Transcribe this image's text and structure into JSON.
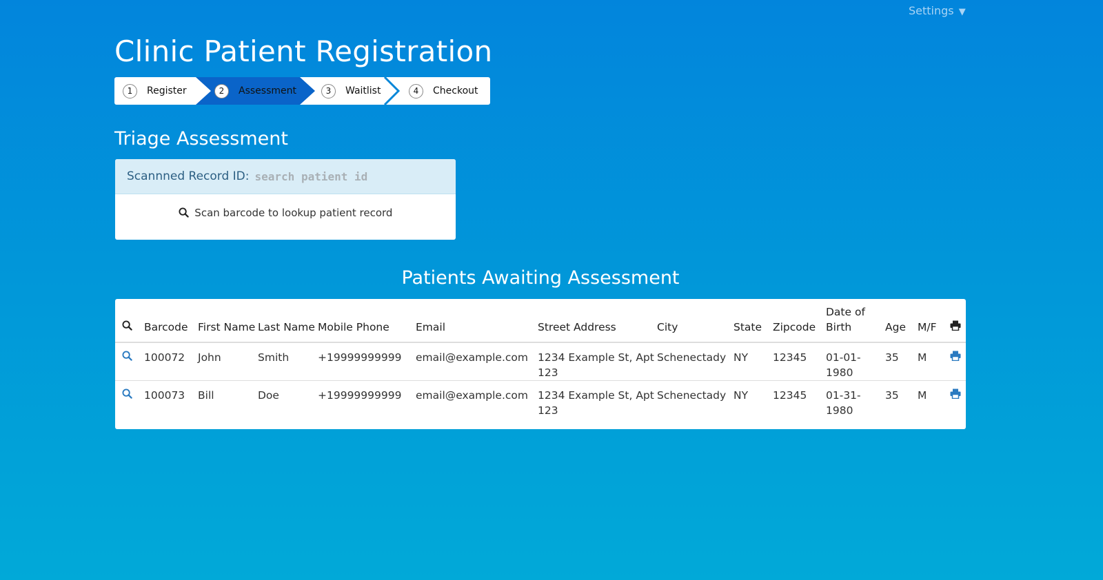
{
  "header": {
    "settings_label": "Settings",
    "settings_caret": "▼",
    "title": "Clinic Patient Registration"
  },
  "steps": [
    {
      "number": "1",
      "label": "Register",
      "active": false
    },
    {
      "number": "2",
      "label": "Assessment",
      "active": true
    },
    {
      "number": "3",
      "label": "Waitlist",
      "active": false
    },
    {
      "number": "4",
      "label": "Checkout",
      "active": false
    }
  ],
  "triage": {
    "title": "Triage Assessment",
    "record_label": "Scannned Record ID:",
    "search_placeholder": "search patient id",
    "hint": "Scan barcode to lookup patient record"
  },
  "patients": {
    "title": "Patients Awaiting Assessment",
    "columns": [
      "Barcode",
      "First Name",
      "Last Name",
      "Mobile Phone",
      "Email",
      "Street Address",
      "City",
      "State",
      "Zipcode",
      "Date of Birth",
      "Age",
      "M/F"
    ],
    "rows": [
      {
        "barcode": "100072",
        "first": "John",
        "last": "Smith",
        "phone": "+19999999999",
        "email": "email@example.com",
        "address": "1234 Example St, Apt 123",
        "city": "Schenectady",
        "state": "NY",
        "zip": "12345",
        "dob": "01-01-1980",
        "age": "35",
        "sex": "M"
      },
      {
        "barcode": "100073",
        "first": "Bill",
        "last": "Doe",
        "phone": "+19999999999",
        "email": "email@example.com",
        "address": "1234 Example St, Apt 123",
        "city": "Schenectady",
        "state": "NY",
        "zip": "12345",
        "dob": "01-31-1980",
        "age": "35",
        "sex": "M"
      }
    ]
  },
  "colors": {
    "accent": "#0a64c9",
    "icon_blue": "#2a7ac0"
  },
  "icons": {
    "search": "search-icon",
    "print": "print-icon"
  }
}
